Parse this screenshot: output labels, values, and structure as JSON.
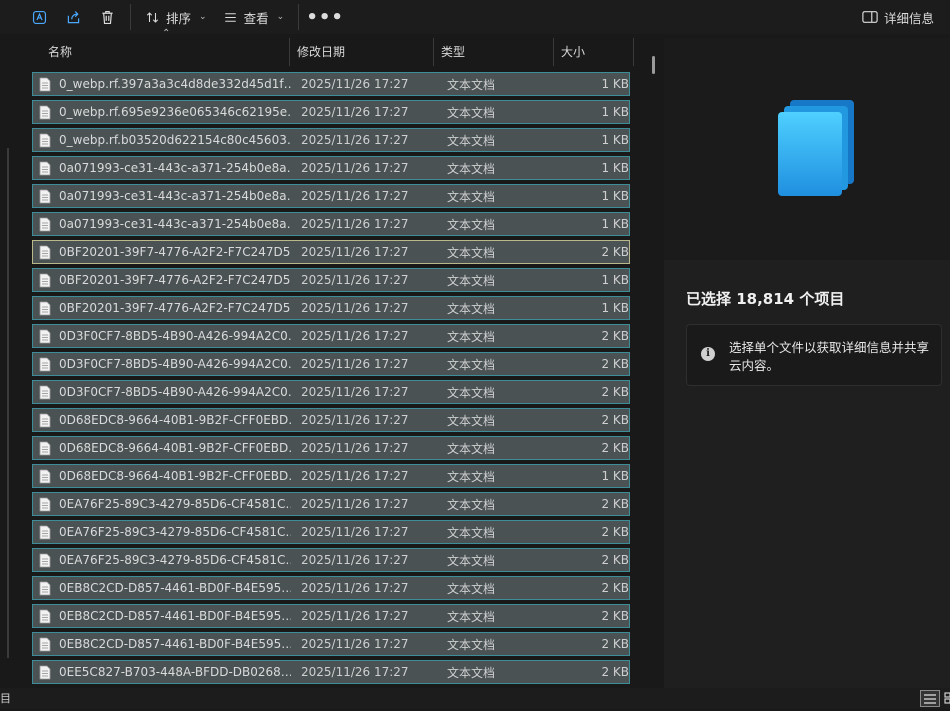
{
  "toolbar": {
    "sort_label": "排序",
    "view_label": "查看",
    "more_label": "•••",
    "details_label": "详细信息"
  },
  "columns": {
    "name": "名称",
    "date": "修改日期",
    "type": "类型",
    "size": "大小"
  },
  "files": [
    {
      "name": "0_webp.rf.397a3a3c4d8de332d45d1f…",
      "date": "2025/11/26 17:27",
      "type": "文本文档",
      "size": "1 KB"
    },
    {
      "name": "0_webp.rf.695e9236e065346c62195e…",
      "date": "2025/11/26 17:27",
      "type": "文本文档",
      "size": "1 KB"
    },
    {
      "name": "0_webp.rf.b03520d622154c80c45603…",
      "date": "2025/11/26 17:27",
      "type": "文本文档",
      "size": "1 KB"
    },
    {
      "name": "0a071993-ce31-443c-a371-254b0e8a…",
      "date": "2025/11/26 17:27",
      "type": "文本文档",
      "size": "1 KB"
    },
    {
      "name": "0a071993-ce31-443c-a371-254b0e8a…",
      "date": "2025/11/26 17:27",
      "type": "文本文档",
      "size": "1 KB"
    },
    {
      "name": "0a071993-ce31-443c-a371-254b0e8a…",
      "date": "2025/11/26 17:27",
      "type": "文本文档",
      "size": "1 KB"
    },
    {
      "name": "0BF20201-39F7-4776-A2F2-F7C247D5…",
      "date": "2025/11/26 17:27",
      "type": "文本文档",
      "size": "2 KB"
    },
    {
      "name": "0BF20201-39F7-4776-A2F2-F7C247D5…",
      "date": "2025/11/26 17:27",
      "type": "文本文档",
      "size": "1 KB"
    },
    {
      "name": "0BF20201-39F7-4776-A2F2-F7C247D5…",
      "date": "2025/11/26 17:27",
      "type": "文本文档",
      "size": "1 KB"
    },
    {
      "name": "0D3F0CF7-8BD5-4B90-A426-994A2C0…",
      "date": "2025/11/26 17:27",
      "type": "文本文档",
      "size": "2 KB"
    },
    {
      "name": "0D3F0CF7-8BD5-4B90-A426-994A2C0…",
      "date": "2025/11/26 17:27",
      "type": "文本文档",
      "size": "2 KB"
    },
    {
      "name": "0D3F0CF7-8BD5-4B90-A426-994A2C0…",
      "date": "2025/11/26 17:27",
      "type": "文本文档",
      "size": "2 KB"
    },
    {
      "name": "0D68EDC8-9664-40B1-9B2F-CFF0EBD…",
      "date": "2025/11/26 17:27",
      "type": "文本文档",
      "size": "2 KB"
    },
    {
      "name": "0D68EDC8-9664-40B1-9B2F-CFF0EBD…",
      "date": "2025/11/26 17:27",
      "type": "文本文档",
      "size": "2 KB"
    },
    {
      "name": "0D68EDC8-9664-40B1-9B2F-CFF0EBD…",
      "date": "2025/11/26 17:27",
      "type": "文本文档",
      "size": "1 KB"
    },
    {
      "name": "0EA76F25-89C3-4279-85D6-CF4581C…",
      "date": "2025/11/26 17:27",
      "type": "文本文档",
      "size": "2 KB"
    },
    {
      "name": "0EA76F25-89C3-4279-85D6-CF4581C…",
      "date": "2025/11/26 17:27",
      "type": "文本文档",
      "size": "2 KB"
    },
    {
      "name": "0EA76F25-89C3-4279-85D6-CF4581C…",
      "date": "2025/11/26 17:27",
      "type": "文本文档",
      "size": "2 KB"
    },
    {
      "name": "0EB8C2CD-D857-4461-BD0F-B4E595…",
      "date": "2025/11/26 17:27",
      "type": "文本文档",
      "size": "2 KB"
    },
    {
      "name": "0EB8C2CD-D857-4461-BD0F-B4E595…",
      "date": "2025/11/26 17:27",
      "type": "文本文档",
      "size": "2 KB"
    },
    {
      "name": "0EB8C2CD-D857-4461-BD0F-B4E595…",
      "date": "2025/11/26 17:27",
      "type": "文本文档",
      "size": "2 KB"
    },
    {
      "name": "0EE5C827-B703-448A-BFDD-DB0268…",
      "date": "2025/11/26 17:27",
      "type": "文本文档",
      "size": "2 KB"
    }
  ],
  "details": {
    "selection_count": "已选择 18,814 个项目",
    "info_text": "选择单个文件以获取详细信息并共享云内容。"
  },
  "status": {
    "left_text": "目"
  },
  "colors": {
    "selection_bg": "#4a5254",
    "selection_border": "#3c8d98",
    "accent": "#2fa6e6"
  }
}
